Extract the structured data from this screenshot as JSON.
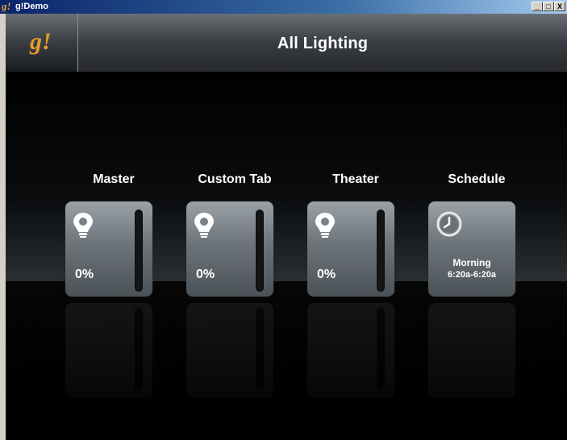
{
  "window": {
    "icon_glyph": "g!",
    "title": "g!Demo",
    "controls": {
      "minimize": "_",
      "maximize": "□",
      "close": "X"
    }
  },
  "header": {
    "logo": "g!",
    "title": "All Lighting"
  },
  "tiles": [
    {
      "label": "Master",
      "value": "0%",
      "icon": "lightbulb-icon",
      "level": 0
    },
    {
      "label": "Custom Tab",
      "value": "0%",
      "icon": "lightbulb-icon",
      "level": 0
    },
    {
      "label": "Theater",
      "value": "0%",
      "icon": "lightbulb-icon",
      "level": 0
    },
    {
      "label": "Schedule",
      "icon": "clock-icon",
      "schedule_name": "Morning",
      "schedule_time": "6:20a-6:20a"
    }
  ],
  "colors": {
    "accent_logo": "#e89a2a",
    "titlebar": "#0a246a"
  }
}
